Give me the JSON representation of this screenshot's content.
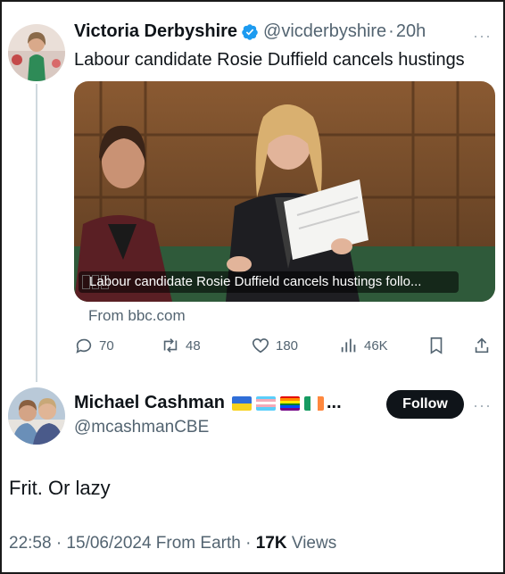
{
  "quoted_tweet": {
    "author_name": "Victoria Derbyshire",
    "handle": "@vicderbyshire",
    "separator": "·",
    "time_ago": "20h",
    "more_glyph": "···",
    "text": "Labour candidate Rosie Duffield cancels hustings",
    "media_caption": "Labour candidate Rosie Duffield cancels hustings follo...",
    "link_source": "From bbc.com",
    "actions": {
      "replies": "70",
      "reposts": "48",
      "likes": "180",
      "views": "46K"
    }
  },
  "tweet": {
    "author_name": "Michael Cashman",
    "name_suffix": "...",
    "handle": "@mcashmanCBE",
    "follow_label": "Follow",
    "more_glyph": "···",
    "body": "Frit. Or lazy",
    "timestamp": "22:58 · 15/06/2024 From Earth",
    "meta_sep": "·",
    "views_count": "17K",
    "views_label": "Views"
  },
  "icons": {
    "verified": "verified-badge-icon",
    "reply": "reply-icon",
    "repost": "repost-icon",
    "like": "heart-icon",
    "views": "bar-chart-icon",
    "bookmark": "bookmark-icon",
    "share": "share-icon"
  },
  "colors": {
    "text_primary": "#0f1419",
    "text_secondary": "#536471",
    "verified_blue": "#1d9bf0",
    "follow_bg": "#0f1419"
  }
}
